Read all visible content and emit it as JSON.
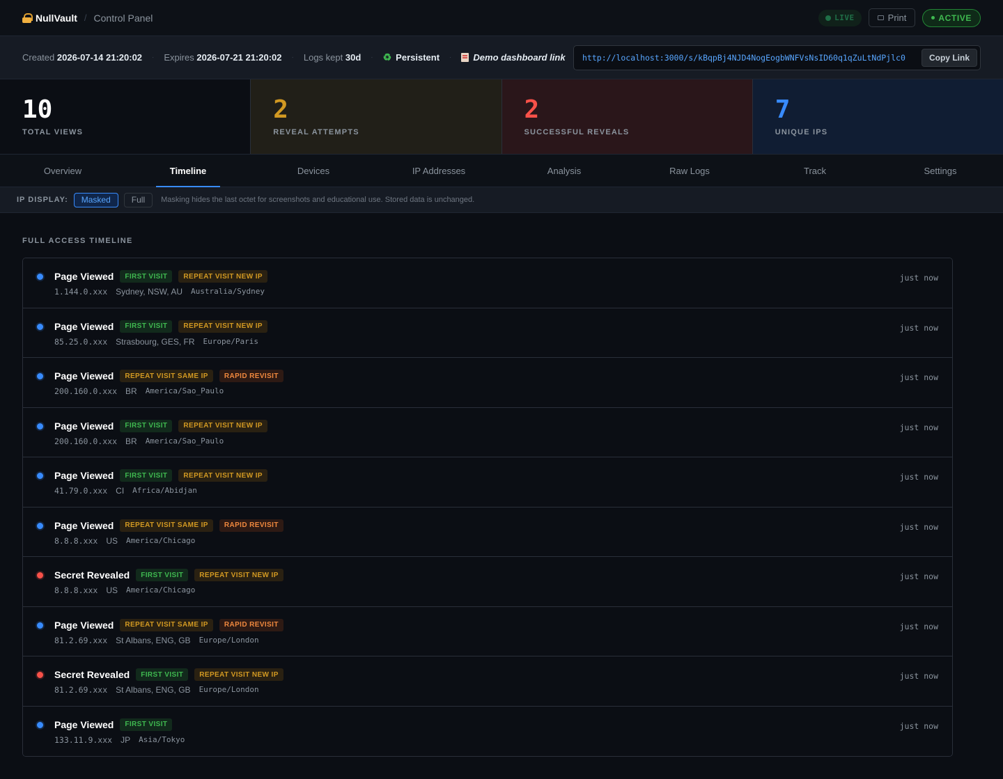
{
  "header": {
    "brand": "NullVault",
    "separator": "/",
    "crumb": "Control Panel",
    "live_label": "LIVE",
    "print_label": "Print",
    "active_label": "ACTIVE"
  },
  "meta": {
    "created_label": "Created",
    "created_value": "2026-07-14 21:20:02",
    "expires_label": "Expires",
    "expires_value": "2026-07-21 21:20:02",
    "logs_label": "Logs kept",
    "logs_value": "30d",
    "persistent_label": "Persistent",
    "demo_label": "Demo dashboard link",
    "link": "http://localhost:3000/s/kBqpBj4NJD4NogEogbWNFVsNsID60q1qZuLtNdPjlc0",
    "copy_label": "Copy Link"
  },
  "stats": [
    {
      "value": "10",
      "label": "TOTAL VIEWS"
    },
    {
      "value": "2",
      "label": "REVEAL ATTEMPTS"
    },
    {
      "value": "2",
      "label": "SUCCESSFUL REVEALS"
    },
    {
      "value": "7",
      "label": "UNIQUE IPS"
    }
  ],
  "tabs": [
    {
      "label": "Overview"
    },
    {
      "label": "Timeline"
    },
    {
      "label": "Devices"
    },
    {
      "label": "IP Addresses"
    },
    {
      "label": "Analysis"
    },
    {
      "label": "Raw Logs"
    },
    {
      "label": "Track"
    },
    {
      "label": "Settings"
    }
  ],
  "selected_tab": "Timeline",
  "ip_display": {
    "label": "IP DISPLAY:",
    "masked_label": "Masked",
    "full_label": "Full",
    "selected": "Masked",
    "note": "Masking hides the last octet for screenshots and educational use. Stored data is unchanged."
  },
  "timeline": {
    "title": "FULL ACCESS TIMELINE",
    "events": [
      {
        "type": "view",
        "event": "Page Viewed",
        "tags": [
          "FIRST VISIT",
          "REPEAT VISIT NEW IP"
        ],
        "ip": "1.144.0.xxx",
        "location": "Sydney, NSW, AU",
        "timezone": "Australia/Sydney",
        "time": "just now"
      },
      {
        "type": "view",
        "event": "Page Viewed",
        "tags": [
          "FIRST VISIT",
          "REPEAT VISIT NEW IP"
        ],
        "ip": "85.25.0.xxx",
        "location": "Strasbourg, GES, FR",
        "timezone": "Europe/Paris",
        "time": "just now"
      },
      {
        "type": "view",
        "event": "Page Viewed",
        "tags": [
          "REPEAT VISIT SAME IP",
          "RAPID REVISIT"
        ],
        "ip": "200.160.0.xxx",
        "location": "BR",
        "timezone": "America/Sao_Paulo",
        "time": "just now"
      },
      {
        "type": "view",
        "event": "Page Viewed",
        "tags": [
          "FIRST VISIT",
          "REPEAT VISIT NEW IP"
        ],
        "ip": "200.160.0.xxx",
        "location": "BR",
        "timezone": "America/Sao_Paulo",
        "time": "just now"
      },
      {
        "type": "view",
        "event": "Page Viewed",
        "tags": [
          "FIRST VISIT",
          "REPEAT VISIT NEW IP"
        ],
        "ip": "41.79.0.xxx",
        "location": "CI",
        "timezone": "Africa/Abidjan",
        "time": "just now"
      },
      {
        "type": "view",
        "event": "Page Viewed",
        "tags": [
          "REPEAT VISIT SAME IP",
          "RAPID REVISIT"
        ],
        "ip": "8.8.8.xxx",
        "location": "US",
        "timezone": "America/Chicago",
        "time": "just now"
      },
      {
        "type": "reveal",
        "event": "Secret Revealed",
        "tags": [
          "FIRST VISIT",
          "REPEAT VISIT NEW IP"
        ],
        "ip": "8.8.8.xxx",
        "location": "US",
        "timezone": "America/Chicago",
        "time": "just now"
      },
      {
        "type": "view",
        "event": "Page Viewed",
        "tags": [
          "REPEAT VISIT SAME IP",
          "RAPID REVISIT"
        ],
        "ip": "81.2.69.xxx",
        "location": "St Albans, ENG, GB",
        "timezone": "Europe/London",
        "time": "just now"
      },
      {
        "type": "reveal",
        "event": "Secret Revealed",
        "tags": [
          "FIRST VISIT",
          "REPEAT VISIT NEW IP"
        ],
        "ip": "81.2.69.xxx",
        "location": "St Albans, ENG, GB",
        "timezone": "Europe/London",
        "time": "just now"
      },
      {
        "type": "view",
        "event": "Page Viewed",
        "tags": [
          "FIRST VISIT"
        ],
        "ip": "133.11.9.xxx",
        "location": "JP",
        "timezone": "Asia/Tokyo",
        "time": "just now"
      }
    ]
  },
  "colors": {
    "accent": "#388bfd",
    "live_green": "#3fb950",
    "warn": "#d29922",
    "danger": "#f85149"
  }
}
